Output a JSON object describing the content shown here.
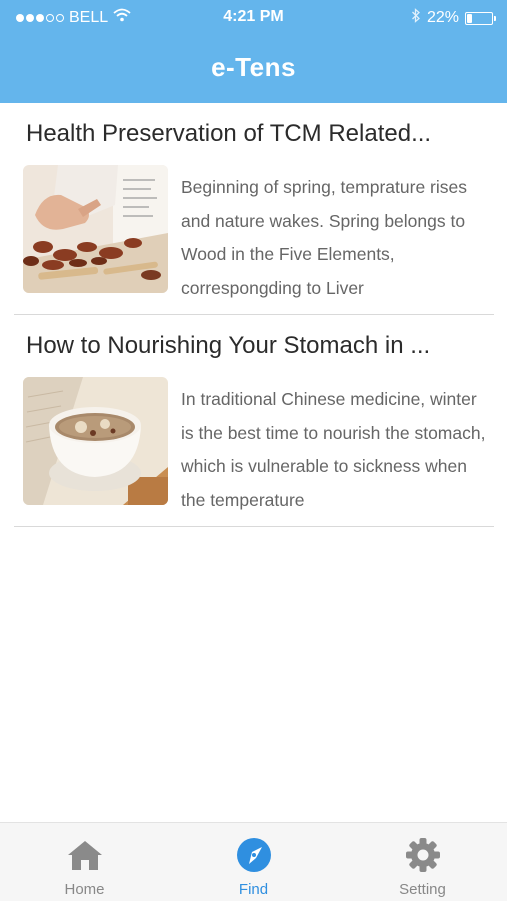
{
  "status_bar": {
    "carrier": "BELL",
    "time": "4:21 PM",
    "battery_percent": "22%",
    "battery_level": 0.22,
    "signal_bars_filled": 3,
    "signal_bars_total": 5,
    "icons": [
      "wifi-icon",
      "bluetooth-icon",
      "battery-icon"
    ]
  },
  "header": {
    "title": "e-Tens",
    "background_color": "#64b5ec"
  },
  "articles": [
    {
      "title": "Health Preservation of TCM Related...",
      "excerpt": "Beginning of spring, temprature rises and nature wakes. Spring belongs to Wood in the Five Elements, correspongding to Liver",
      "thumbnail": "herbal-medicine-image"
    },
    {
      "title": "How to Nourishing Your Stomach in ...",
      "excerpt": "In traditional Chinese medicine, winter is the best time to nourish the stomach, which is vulnerable to sickness when the temperature",
      "thumbnail": "soup-bowl-image"
    }
  ],
  "tabbar": {
    "active_color": "#2f8fe0",
    "tabs": [
      {
        "label": "Home",
        "icon": "home-icon",
        "active": false
      },
      {
        "label": "Find",
        "icon": "compass-icon",
        "active": true
      },
      {
        "label": "Setting",
        "icon": "gear-icon",
        "active": false
      }
    ]
  }
}
